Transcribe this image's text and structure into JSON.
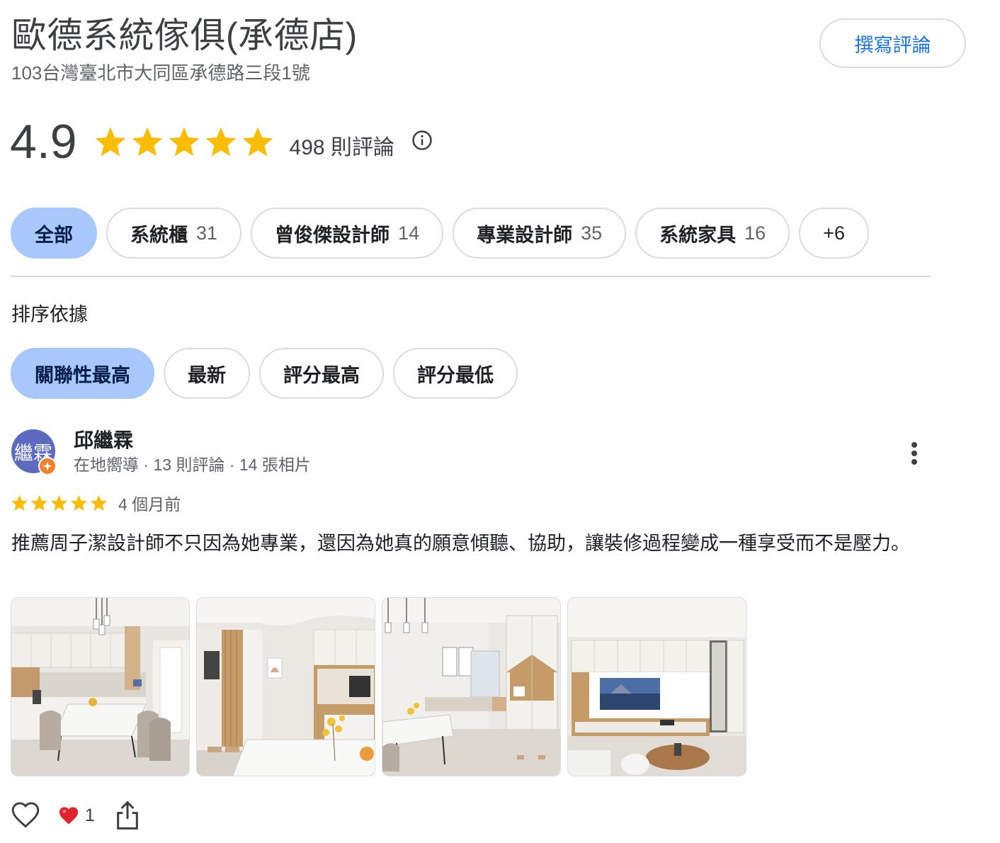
{
  "place": {
    "name": "歐德系統傢俱(承德店)",
    "address": "103台灣臺北市大同區承德路三段1號",
    "write_review_label": "撰寫評論",
    "rating": "4.9",
    "rating_stars": 5,
    "review_count_label": "498 則評論",
    "info_icon": "info-icon",
    "star_color": "#fbbc04"
  },
  "topic_chips": [
    {
      "label": "全部",
      "count": "",
      "active": true
    },
    {
      "label": "系統櫃",
      "count": "31",
      "active": false
    },
    {
      "label": "曾俊傑設計師",
      "count": "14",
      "active": false
    },
    {
      "label": "專業設計師",
      "count": "35",
      "active": false
    },
    {
      "label": "系統家具",
      "count": "16",
      "active": false
    },
    {
      "label": "+6",
      "count": "",
      "active": false
    }
  ],
  "sort": {
    "label": "排序依據",
    "options": [
      {
        "label": "關聯性最高",
        "active": true
      },
      {
        "label": "最新",
        "active": false
      },
      {
        "label": "評分最高",
        "active": false
      },
      {
        "label": "評分最低",
        "active": false
      }
    ]
  },
  "review": {
    "avatar_text": "繼霖",
    "avatar_color": "#5c6bc0",
    "badge_color": "#f4802a",
    "reviewer_name": "邱繼霖",
    "reviewer_meta": "在地嚮導 · 13 則評論 · 14 張相片",
    "stars": 5,
    "time": "4 個月前",
    "text": "推薦周子潔設計師不只因為她專業，還因為她真的願意傾聽、協助，讓裝修過程變成一種享受而不是壓力。",
    "photos": [
      "dining-room-photo",
      "entryway-photo",
      "living-room-photo",
      "tv-wall-photo"
    ],
    "reaction_icon": "heart-emoji-icon",
    "reaction_count": "1",
    "like_icon": "heart-outline-icon",
    "share_icon": "share-icon"
  },
  "accent": {
    "blue": "#1a73e8",
    "chip_active": "#a8c7fa"
  }
}
